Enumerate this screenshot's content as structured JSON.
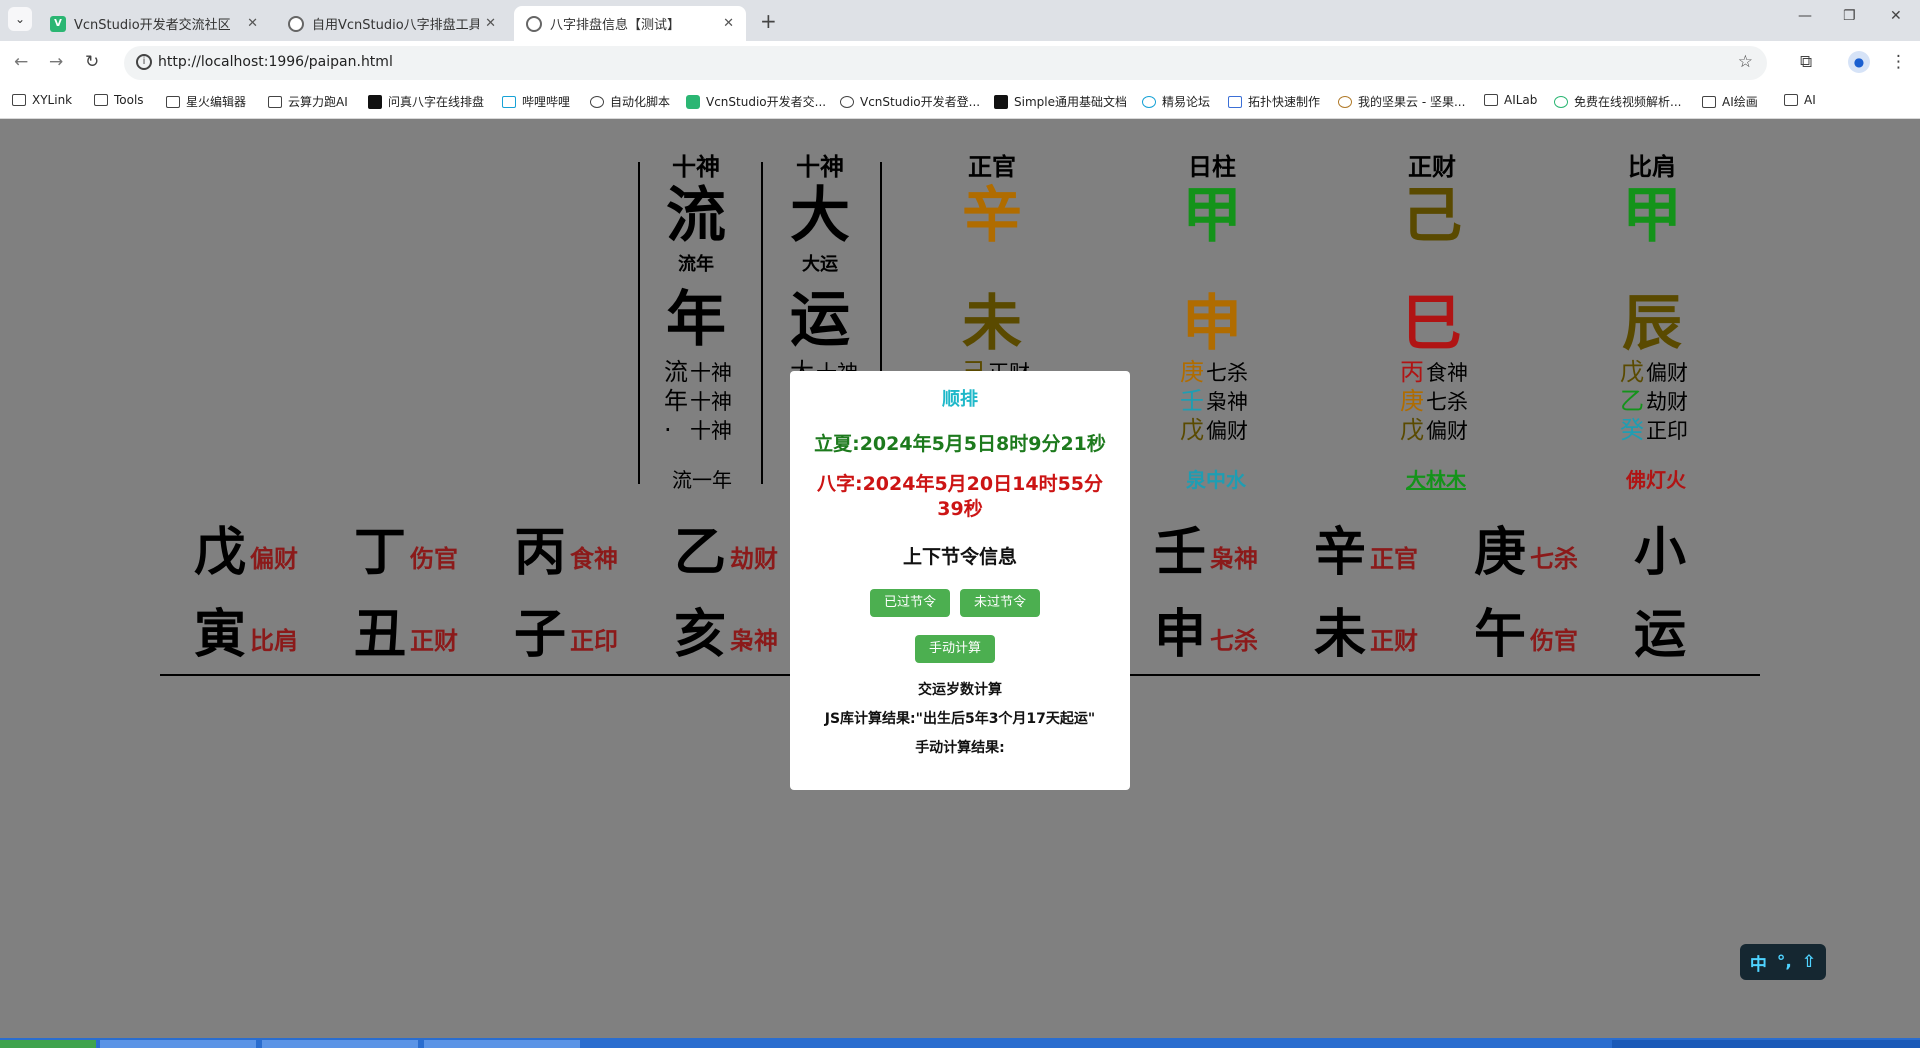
{
  "browser": {
    "tabs": [
      {
        "title": "VcnStudio开发者交流社区",
        "active": false
      },
      {
        "title": "自用VcnStudio八字排盘工具",
        "active": false
      },
      {
        "title": "八字排盘信息【测试】",
        "active": true
      }
    ],
    "url": "http://localhost:1996/paipan.html",
    "bookmarks": [
      "XYLink",
      "Tools",
      "星火编辑器",
      "云算力跑AI",
      "问真八字在线排盘",
      "哔哩哔哩",
      "自动化脚本",
      "VcnStudio开发者交...",
      "VcnStudio开发者登...",
      "Simple通用基础文档",
      "精易论坛",
      "拓扑快速制作",
      "我的坚果云 - 坚果...",
      "AILab",
      "免费在线视频解析...",
      "AI绘画",
      "AI"
    ]
  },
  "chart": {
    "liunian": {
      "header": "十神",
      "stem": "流",
      "label": "流年",
      "branch": "年",
      "hidden": [
        "流",
        "年",
        "·"
      ],
      "hidden_gods": [
        "十神",
        "十神",
        "十神"
      ],
      "nayin": "流一年"
    },
    "dayun": {
      "header": "十神",
      "stem": "大",
      "label": "大运",
      "branch": "运",
      "hidden": [
        "大"
      ],
      "hidden_gods": [
        "十神"
      ],
      "nayin": ""
    },
    "pillars": [
      {
        "header": "正官",
        "stem": "辛",
        "stem_color": "#b06c00",
        "branch": "未",
        "branch_color": "#5a4a00",
        "hidden": [
          "己"
        ],
        "hidden_colors": [
          "#5a4a00"
        ],
        "hidden_gods": [
          "正财"
        ],
        "nayin": "",
        "nayin_color": "#111"
      },
      {
        "header": "日柱",
        "stem": "甲",
        "stem_color": "#14931a",
        "branch": "申",
        "branch_color": "#b06c00",
        "hidden": [
          "庚",
          "壬",
          "戊"
        ],
        "hidden_colors": [
          "#b06c00",
          "#1f9db2",
          "#5a4a00"
        ],
        "hidden_gods": [
          "七杀",
          "枭神",
          "偏财"
        ],
        "nayin": "泉中水",
        "nayin_color": "#1f9db2"
      },
      {
        "header": "正财",
        "stem": "己",
        "stem_color": "#5a4a00",
        "branch": "巳",
        "branch_color": "#b01414",
        "hidden": [
          "丙",
          "庚",
          "戊"
        ],
        "hidden_colors": [
          "#b01414",
          "#b06c00",
          "#5a4a00"
        ],
        "hidden_gods": [
          "食神",
          "七杀",
          "偏财"
        ],
        "nayin": "大林木",
        "nayin_color": "#14931a"
      },
      {
        "header": "比肩",
        "stem": "甲",
        "stem_color": "#14931a",
        "branch": "辰",
        "branch_color": "#5a4a00",
        "hidden": [
          "戊",
          "乙",
          "癸"
        ],
        "hidden_colors": [
          "#5a4a00",
          "#14931a",
          "#1f9db2"
        ],
        "hidden_gods": [
          "偏财",
          "劫财",
          "正印"
        ],
        "nayin": "佛灯火",
        "nayin_color": "#b01414"
      }
    ],
    "luck_row": [
      {
        "stem": "戊",
        "stem_god": "偏财",
        "branch": "寅",
        "branch_god": "比肩"
      },
      {
        "stem": "丁",
        "stem_god": "伤官",
        "branch": "丑",
        "branch_god": "正财"
      },
      {
        "stem": "丙",
        "stem_god": "食神",
        "branch": "子",
        "branch_god": "正印"
      },
      {
        "stem": "乙",
        "stem_god": "劫财",
        "branch": "亥",
        "branch_god": "枭神"
      },
      {
        "stem": "壬",
        "stem_god": "枭神",
        "branch": "申",
        "branch_god": "七杀"
      },
      {
        "stem": "辛",
        "stem_god": "正官",
        "branch": "未",
        "branch_god": "正财"
      },
      {
        "stem": "庚",
        "stem_god": "七杀",
        "branch": "午",
        "branch_god": "伤官"
      },
      {
        "stem": "小",
        "stem_god": "",
        "branch": "运",
        "branch_god": ""
      }
    ]
  },
  "modal": {
    "title": "顺排",
    "jieqi": "立夏:2024年5月5日8时9分21秒",
    "bazi": "八字:2024年5月20日14时55分39秒",
    "section": "上下节令信息",
    "btn_past": "已过节令",
    "btn_future": "未过节令",
    "btn_manual": "手动计算",
    "step_title": "交运岁数计算",
    "js_result": "JS库计算结果:\"出生后5年3个月17天起运\"",
    "manual_result": "手动计算结果:"
  },
  "ime": {
    "lang": "中",
    "punct": "°,",
    "mode": "⇧"
  }
}
